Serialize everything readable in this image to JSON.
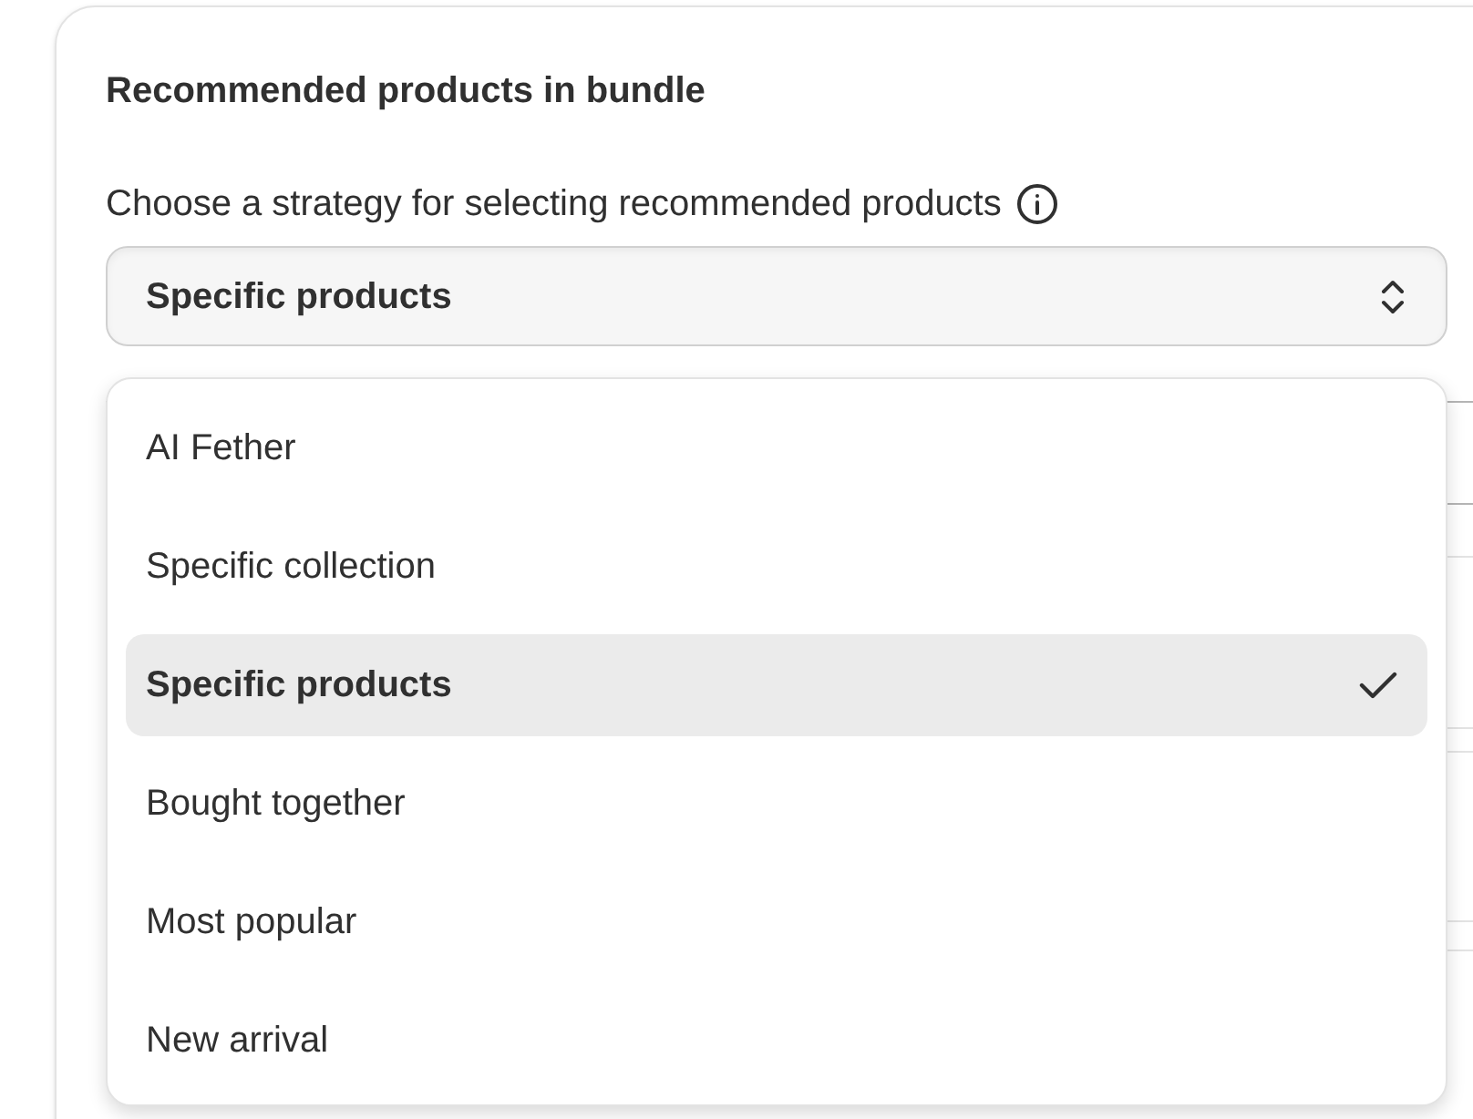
{
  "card": {
    "title": "Recommended products in bundle",
    "strategy_label": "Choose a strategy for selecting recommended products",
    "select": {
      "value": "Specific products",
      "expanded": true
    },
    "options": [
      {
        "label": "AI Fether",
        "selected": false
      },
      {
        "label": "Specific collection",
        "selected": false
      },
      {
        "label": "Specific products",
        "selected": true
      },
      {
        "label": "Bought together",
        "selected": false
      },
      {
        "label": "Most popular",
        "selected": false
      },
      {
        "label": "New arrival",
        "selected": false
      }
    ]
  }
}
